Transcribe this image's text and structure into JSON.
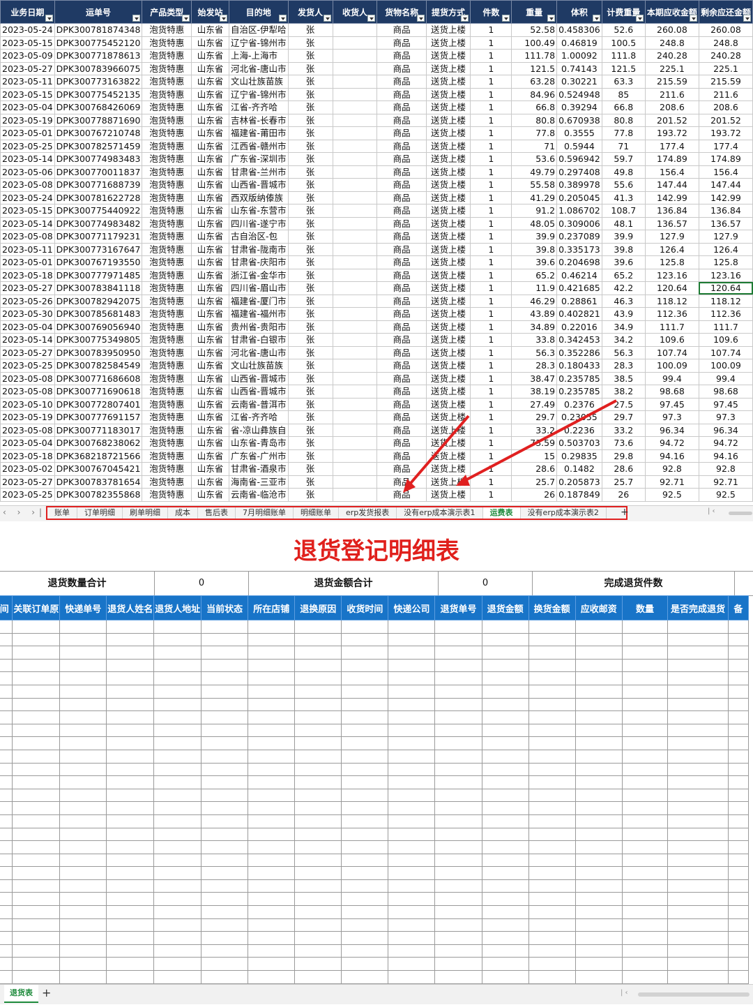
{
  "shipping_sheet": {
    "headers": [
      "业务日期",
      "运单号",
      "产品类型",
      "始发站",
      "目的地",
      "发货人",
      "收货人",
      "货物名称",
      "提货方式",
      "件数",
      "重量",
      "体积",
      "计费重量",
      "本期应收金额",
      "剩余应还金额"
    ],
    "rows": [
      [
        "2023-05-24",
        "DPK300781874348",
        "泡货特惠",
        "山东省",
        "自治区-伊犁哈",
        "张",
        "",
        "商品",
        "送货上楼",
        "1",
        "52.58",
        "0.458306",
        "52.6",
        "260.08",
        "260.08"
      ],
      [
        "2023-05-15",
        "DPK300775452120",
        "泡货特惠",
        "山东省",
        "辽宁省-锦州市",
        "张",
        "",
        "商品",
        "送货上楼",
        "1",
        "100.49",
        "0.46819",
        "100.5",
        "248.8",
        "248.8"
      ],
      [
        "2023-05-09",
        "DPK300771878613",
        "泡货特惠",
        "山东省",
        "上海-上海市",
        "张",
        "",
        "商品",
        "送货上楼",
        "1",
        "111.78",
        "1.00092",
        "111.8",
        "240.28",
        "240.28"
      ],
      [
        "2023-05-27",
        "DPK300783966075",
        "泡货特惠",
        "山东省",
        "河北省-唐山市",
        "张",
        "",
        "商品",
        "送货上楼",
        "1",
        "121.5",
        "0.74143",
        "121.5",
        "225.1",
        "225.1"
      ],
      [
        "2023-05-11",
        "DPK300773163822",
        "泡货特惠",
        "山东省",
        "文山壮族苗族",
        "张",
        "",
        "商品",
        "送货上楼",
        "1",
        "63.28",
        "0.30221",
        "63.3",
        "215.59",
        "215.59"
      ],
      [
        "2023-05-15",
        "DPK300775452135",
        "泡货特惠",
        "山东省",
        "辽宁省-锦州市",
        "张",
        "",
        "商品",
        "送货上楼",
        "1",
        "84.96",
        "0.524948",
        "85",
        "211.6",
        "211.6"
      ],
      [
        "2023-05-04",
        "DPK300768426069",
        "泡货特惠",
        "山东省",
        "江省-齐齐哈",
        "张",
        "",
        "商品",
        "送货上楼",
        "1",
        "66.8",
        "0.39294",
        "66.8",
        "208.6",
        "208.6"
      ],
      [
        "2023-05-19",
        "DPK300778871690",
        "泡货特惠",
        "山东省",
        "吉林省-长春市",
        "张",
        "",
        "商品",
        "送货上楼",
        "1",
        "80.8",
        "0.670938",
        "80.8",
        "201.52",
        "201.52"
      ],
      [
        "2023-05-01",
        "DPK300767210748",
        "泡货特惠",
        "山东省",
        "福建省-莆田市",
        "张",
        "",
        "商品",
        "送货上楼",
        "1",
        "77.8",
        "0.3555",
        "77.8",
        "193.72",
        "193.72"
      ],
      [
        "2023-05-25",
        "DPK300782571459",
        "泡货特惠",
        "山东省",
        "江西省-赣州市",
        "张",
        "",
        "商品",
        "送货上楼",
        "1",
        "71",
        "0.5944",
        "71",
        "177.4",
        "177.4"
      ],
      [
        "2023-05-14",
        "DPK300774983483",
        "泡货特惠",
        "山东省",
        "广东省-深圳市",
        "张",
        "",
        "商品",
        "送货上楼",
        "1",
        "53.6",
        "0.596942",
        "59.7",
        "174.89",
        "174.89"
      ],
      [
        "2023-05-06",
        "DPK300770011837",
        "泡货特惠",
        "山东省",
        "甘肃省-兰州市",
        "张",
        "",
        "商品",
        "送货上楼",
        "1",
        "49.79",
        "0.297408",
        "49.8",
        "156.4",
        "156.4"
      ],
      [
        "2023-05-08",
        "DPK300771688739",
        "泡货特惠",
        "山东省",
        "山西省-晋城市",
        "张",
        "",
        "商品",
        "送货上楼",
        "1",
        "55.58",
        "0.389978",
        "55.6",
        "147.44",
        "147.44"
      ],
      [
        "2023-05-24",
        "DPK300781622728",
        "泡货特惠",
        "山东省",
        "西双版纳傣族",
        "张",
        "",
        "商品",
        "送货上楼",
        "1",
        "41.29",
        "0.205045",
        "41.3",
        "142.99",
        "142.99"
      ],
      [
        "2023-05-15",
        "DPK300775440922",
        "泡货特惠",
        "山东省",
        "山东省-东营市",
        "张",
        "",
        "商品",
        "送货上楼",
        "1",
        "91.2",
        "1.086702",
        "108.7",
        "136.84",
        "136.84"
      ],
      [
        "2023-05-14",
        "DPK300774983482",
        "泡货特惠",
        "山东省",
        "四川省-遂宁市",
        "张",
        "",
        "商品",
        "送货上楼",
        "1",
        "48.05",
        "0.309006",
        "48.1",
        "136.57",
        "136.57"
      ],
      [
        "2023-05-08",
        "DPK300771179231",
        "泡货特惠",
        "山东省",
        "古自治区-包",
        "张",
        "",
        "商品",
        "送货上楼",
        "1",
        "39.9",
        "0.237089",
        "39.9",
        "127.9",
        "127.9"
      ],
      [
        "2023-05-11",
        "DPK300773167647",
        "泡货特惠",
        "山东省",
        "甘肃省-陇南市",
        "张",
        "",
        "商品",
        "送货上楼",
        "1",
        "39.8",
        "0.335173",
        "39.8",
        "126.4",
        "126.4"
      ],
      [
        "2023-05-01",
        "DPK300767193550",
        "泡货特惠",
        "山东省",
        "甘肃省-庆阳市",
        "张",
        "",
        "商品",
        "送货上楼",
        "1",
        "39.6",
        "0.204698",
        "39.6",
        "125.8",
        "125.8"
      ],
      [
        "2023-05-18",
        "DPK300777971485",
        "泡货特惠",
        "山东省",
        "浙江省-金华市",
        "张",
        "",
        "商品",
        "送货上楼",
        "1",
        "65.2",
        "0.46214",
        "65.2",
        "123.16",
        "123.16"
      ],
      [
        "2023-05-27",
        "DPK300783841118",
        "泡货特惠",
        "山东省",
        "四川省-眉山市",
        "张",
        "",
        "商品",
        "送货上楼",
        "1",
        "11.9",
        "0.421685",
        "42.2",
        "120.64",
        "120.64"
      ],
      [
        "2023-05-26",
        "DPK300782942075",
        "泡货特惠",
        "山东省",
        "福建省-厦门市",
        "张",
        "",
        "商品",
        "送货上楼",
        "1",
        "46.29",
        "0.28861",
        "46.3",
        "118.12",
        "118.12"
      ],
      [
        "2023-05-30",
        "DPK300785681483",
        "泡货特惠",
        "山东省",
        "福建省-福州市",
        "张",
        "",
        "商品",
        "送货上楼",
        "1",
        "43.89",
        "0.402821",
        "43.9",
        "112.36",
        "112.36"
      ],
      [
        "2023-05-04",
        "DPK300769056940",
        "泡货特惠",
        "山东省",
        "贵州省-贵阳市",
        "张",
        "",
        "商品",
        "送货上楼",
        "1",
        "34.89",
        "0.22016",
        "34.9",
        "111.7",
        "111.7"
      ],
      [
        "2023-05-14",
        "DPK300775349805",
        "泡货特惠",
        "山东省",
        "甘肃省-白银市",
        "张",
        "",
        "商品",
        "送货上楼",
        "1",
        "33.8",
        "0.342453",
        "34.2",
        "109.6",
        "109.6"
      ],
      [
        "2023-05-27",
        "DPK300783950950",
        "泡货特惠",
        "山东省",
        "河北省-唐山市",
        "张",
        "",
        "商品",
        "送货上楼",
        "1",
        "56.3",
        "0.352286",
        "56.3",
        "107.74",
        "107.74"
      ],
      [
        "2023-05-25",
        "DPK300782584549",
        "泡货特惠",
        "山东省",
        "文山壮族苗族",
        "张",
        "",
        "商品",
        "送货上楼",
        "1",
        "28.3",
        "0.180433",
        "28.3",
        "100.09",
        "100.09"
      ],
      [
        "2023-05-08",
        "DPK300771686608",
        "泡货特惠",
        "山东省",
        "山西省-晋城市",
        "张",
        "",
        "商品",
        "送货上楼",
        "1",
        "38.47",
        "0.235785",
        "38.5",
        "99.4",
        "99.4"
      ],
      [
        "2023-05-08",
        "DPK300771690618",
        "泡货特惠",
        "山东省",
        "山西省-晋城市",
        "张",
        "",
        "商品",
        "送货上楼",
        "1",
        "38.19",
        "0.235785",
        "38.2",
        "98.68",
        "98.68"
      ],
      [
        "2023-05-10",
        "DPK300772807401",
        "泡货特惠",
        "山东省",
        "云南省-普洱市",
        "张",
        "",
        "商品",
        "送货上楼",
        "1",
        "27.49",
        "0.2376",
        "27.5",
        "97.45",
        "97.45"
      ],
      [
        "2023-05-19",
        "DPK300777691157",
        "泡货特惠",
        "山东省",
        "江省-齐齐哈",
        "张",
        "",
        "商品",
        "送货上楼",
        "1",
        "29.7",
        "0.23055",
        "29.7",
        "97.3",
        "97.3"
      ],
      [
        "2023-05-08",
        "DPK300771183017",
        "泡货特惠",
        "山东省",
        "省-凉山彝族自",
        "张",
        "",
        "商品",
        "送货上楼",
        "1",
        "33.2",
        "0.2236",
        "33.2",
        "96.34",
        "96.34"
      ],
      [
        "2023-05-04",
        "DPK300768238062",
        "泡货特惠",
        "山东省",
        "山东省-青岛市",
        "张",
        "",
        "商品",
        "送货上楼",
        "1",
        "73.59",
        "0.503703",
        "73.6",
        "94.72",
        "94.72"
      ],
      [
        "2023-05-18",
        "DPK368218721566",
        "泡货特惠",
        "山东省",
        "广东省-广州市",
        "张",
        "",
        "商品",
        "送货上楼",
        "1",
        "15",
        "0.29835",
        "29.8",
        "94.16",
        "94.16"
      ],
      [
        "2023-05-02",
        "DPK300767045421",
        "泡货特惠",
        "山东省",
        "甘肃省-酒泉市",
        "张",
        "",
        "商品",
        "送货上楼",
        "1",
        "28.6",
        "0.1482",
        "28.6",
        "92.8",
        "92.8"
      ],
      [
        "2023-05-27",
        "DPK300783781654",
        "泡货特惠",
        "山东省",
        "海南省-三亚市",
        "张",
        "",
        "商品",
        "送货上楼",
        "1",
        "25.7",
        "0.205873",
        "25.7",
        "92.71",
        "92.71"
      ],
      [
        "2023-05-25",
        "DPK300782355868",
        "泡货特惠",
        "山东省",
        "云南省-临沧市",
        "张",
        "",
        "商品",
        "送货上楼",
        "1",
        "26",
        "0.187849",
        "26",
        "92.5",
        "92.5"
      ]
    ],
    "sheet_tabs": [
      "账单",
      "订单明细",
      "刷单明细",
      "成本",
      "售后表",
      "7月明细账单",
      "明细账单",
      "erp发货报表",
      "没有erp成本演示表1",
      "运费表",
      "没有erp成本演示表2"
    ],
    "active_tab": "运费表",
    "add_tab_symbol": "+",
    "annotation_color": "#e02020"
  },
  "return_sheet": {
    "title": "退货登记明细表",
    "summary": {
      "qty_label": "退货数量合计",
      "qty_value": "0",
      "amount_label": "退货金额合计",
      "amount_value": "0",
      "completed_label": "完成退货件数"
    },
    "headers": [
      "间",
      "关联订单原",
      "快递单号",
      "退货人姓名",
      "退货人地址",
      "当前状态",
      "所在店铺",
      "退换原因",
      "收货时间",
      "快递公司",
      "退货单号",
      "退货金额",
      "换货金额",
      "应收邮资",
      "数量",
      "是否完成退货",
      "备"
    ],
    "tab": "退货表",
    "add_tab_symbol": "+"
  }
}
